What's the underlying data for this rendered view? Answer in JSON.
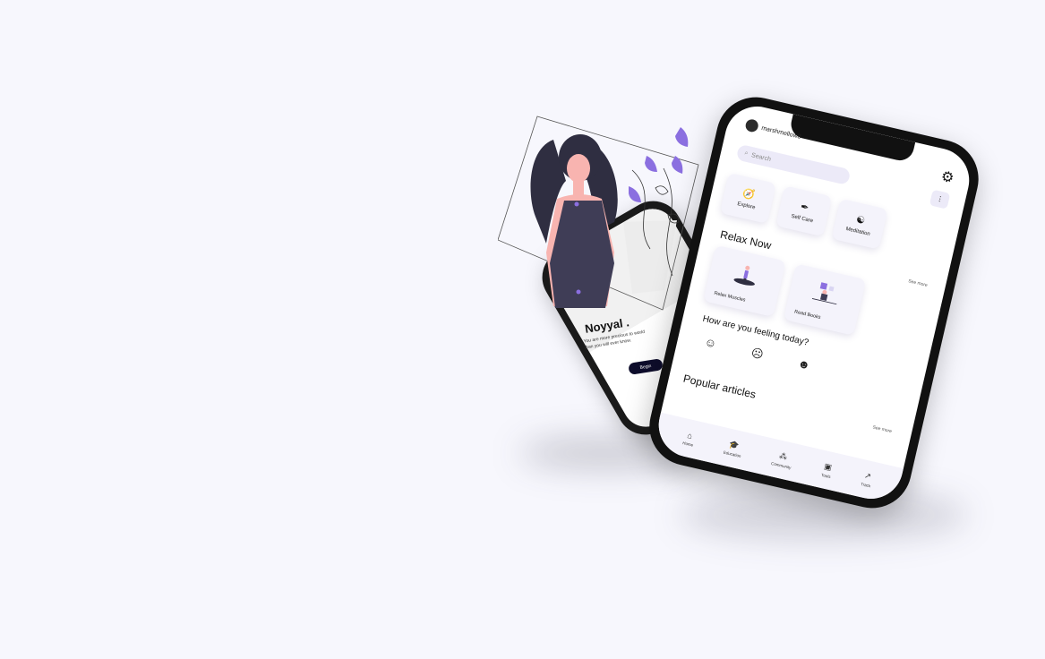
{
  "back_phone": {
    "title": "Noyyal .",
    "subtitle": "You are more precious to world than you will ever know.",
    "begin_label": "Begin"
  },
  "front_phone": {
    "username": "marshmellow8",
    "search_placeholder": "Search",
    "categories": [
      {
        "label": "Explore",
        "icon": "compass-icon"
      },
      {
        "label": "Self Care",
        "icon": "feather-icon"
      },
      {
        "label": "Meditation",
        "icon": "meditation-icon"
      }
    ],
    "relax_title": "Relax Now",
    "see_more": "See more",
    "relax_cards": [
      {
        "label": "Relax Muscles"
      },
      {
        "label": "Read Books"
      }
    ],
    "feeling_title": "How are you feeling today?",
    "moods": [
      {
        "icon": "happy-face-icon"
      },
      {
        "icon": "sad-face-icon"
      },
      {
        "icon": "laughing-face-icon"
      }
    ],
    "articles_title": "Popular articles",
    "articles_see_more": "See more",
    "nav": [
      {
        "label": "Home",
        "icon": "home-icon"
      },
      {
        "label": "Education",
        "icon": "graduation-cap-icon"
      },
      {
        "label": "Community",
        "icon": "community-icon"
      },
      {
        "label": "Tools",
        "icon": "toolbox-icon"
      },
      {
        "label": "Track",
        "icon": "chart-icon"
      }
    ]
  },
  "colors": {
    "background": "#f7f7fd",
    "accent": "#8b6fe0",
    "button_dark": "#0e0d2c"
  }
}
